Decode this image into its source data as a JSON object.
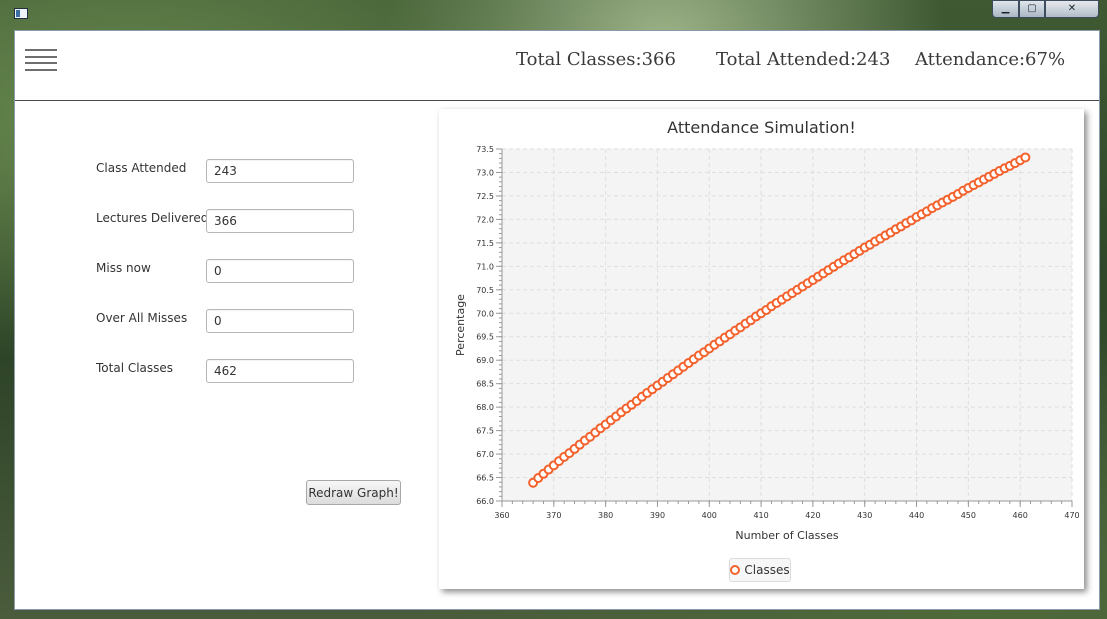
{
  "header": {
    "total_classes": "Total Classes:366",
    "total_attended": "Total Attended:243",
    "attendance": "Attendance:67%"
  },
  "form": {
    "fields": [
      {
        "label": "Class Attended",
        "value": "243"
      },
      {
        "label": "Lectures Delivered",
        "value": "366"
      },
      {
        "label": "Miss now",
        "value": "0"
      },
      {
        "label": "Over All Misses",
        "value": "0"
      },
      {
        "label": "Total Classes",
        "value": "462"
      }
    ],
    "redraw_label": "Redraw Graph!"
  },
  "window_controls": {
    "minimize": "▁",
    "maximize": "▢",
    "close": "✕"
  },
  "colors": {
    "series": "#f3622d",
    "plot_bg": "#f4f4f4",
    "grid": "#dedede"
  },
  "icons": [
    "app-icon",
    "hamburger-menu-icon",
    "minimize-icon",
    "maximize-icon",
    "close-icon"
  ],
  "chart_data": {
    "type": "scatter",
    "title": "Attendance Simulation!",
    "xlabel": "Number of Classes",
    "ylabel": "Percentage",
    "xlim": [
      360,
      470
    ],
    "ylim": [
      66.0,
      73.5
    ],
    "x_ticks": [
      360,
      370,
      380,
      390,
      400,
      410,
      420,
      430,
      440,
      450,
      460,
      470
    ],
    "y_ticks": [
      66.0,
      66.5,
      67.0,
      67.5,
      68.0,
      68.5,
      69.0,
      69.5,
      70.0,
      70.5,
      71.0,
      71.5,
      72.0,
      72.5,
      73.0,
      73.5
    ],
    "grid": true,
    "legend_position": "bottom",
    "series": [
      {
        "name": "Classes",
        "x": [
          366,
          367,
          368,
          369,
          370,
          371,
          372,
          373,
          374,
          375,
          376,
          377,
          378,
          379,
          380,
          381,
          382,
          383,
          384,
          385,
          386,
          387,
          388,
          389,
          390,
          391,
          392,
          393,
          394,
          395,
          396,
          397,
          398,
          399,
          400,
          401,
          402,
          403,
          404,
          405,
          406,
          407,
          408,
          409,
          410,
          411,
          412,
          413,
          414,
          415,
          416,
          417,
          418,
          419,
          420,
          421,
          422,
          423,
          424,
          425,
          426,
          427,
          428,
          429,
          430,
          431,
          432,
          433,
          434,
          435,
          436,
          437,
          438,
          439,
          440,
          441,
          442,
          443,
          444,
          445,
          446,
          447,
          448,
          449,
          450,
          451,
          452,
          453,
          454,
          455,
          456,
          457,
          458,
          459,
          460,
          461
        ],
        "y": [
          66.39,
          66.49,
          66.58,
          66.67,
          66.76,
          66.85,
          66.94,
          67.02,
          67.11,
          67.2,
          67.29,
          67.37,
          67.46,
          67.55,
          67.63,
          67.72,
          67.8,
          67.89,
          67.97,
          68.05,
          68.13,
          68.22,
          68.3,
          68.38,
          68.46,
          68.54,
          68.62,
          68.7,
          68.78,
          68.86,
          68.94,
          69.02,
          69.1,
          69.17,
          69.25,
          69.33,
          69.4,
          69.48,
          69.55,
          69.63,
          69.7,
          69.78,
          69.85,
          69.93,
          70.0,
          70.07,
          70.15,
          70.22,
          70.29,
          70.36,
          70.43,
          70.5,
          70.57,
          70.64,
          70.71,
          70.78,
          70.85,
          70.92,
          70.99,
          71.06,
          71.13,
          71.19,
          71.26,
          71.33,
          71.4,
          71.46,
          71.53,
          71.59,
          71.66,
          71.72,
          71.79,
          71.85,
          71.92,
          71.98,
          72.05,
          72.11,
          72.17,
          72.24,
          72.3,
          72.36,
          72.42,
          72.48,
          72.54,
          72.61,
          72.67,
          72.73,
          72.79,
          72.85,
          72.91,
          72.97,
          73.03,
          73.09,
          73.14,
          73.2,
          73.26,
          73.32
        ]
      }
    ]
  }
}
